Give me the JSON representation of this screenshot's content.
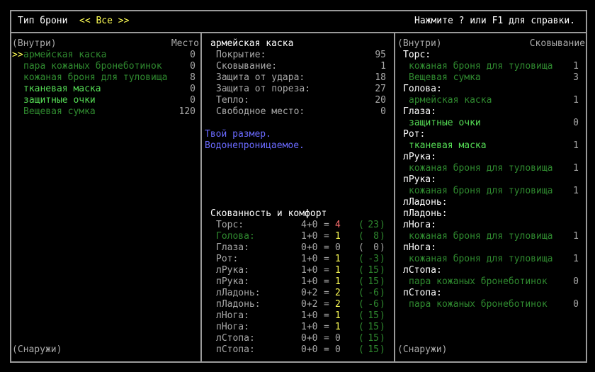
{
  "header": {
    "title": "Тип брони",
    "filter": "<< Все >>",
    "help": "Нажмите ? или F1 для справки."
  },
  "colors": {
    "gray": "#a8a8a8",
    "white": "#ffffff",
    "dark_green": "#2f8a2f",
    "light_green": "#55dd55",
    "yellow": "#ffff55",
    "red": "#ff7070",
    "blue": "#6a6aff",
    "border": "#9a9a9a"
  },
  "left": {
    "inside": "(Внутри)",
    "column": "Место",
    "outside": "(Снаружи)",
    "cursor": ">>",
    "items": [
      {
        "name": "армейская каска",
        "value": "0",
        "color": "dark_green",
        "selected": true
      },
      {
        "name": "пара кожаных бронеботинок",
        "value": "0",
        "color": "dark_green"
      },
      {
        "name": "кожаная броня для туловища",
        "value": "8",
        "color": "dark_green"
      },
      {
        "name": "тканевая маска",
        "value": "0",
        "color": "light_green"
      },
      {
        "name": "защитные очки",
        "value": "0",
        "color": "light_green"
      },
      {
        "name": "Вещевая сумка",
        "value": "120",
        "color": "dark_green"
      }
    ]
  },
  "middle": {
    "item_name": "армейская каска",
    "stats": [
      {
        "label": "Покрытие:",
        "value": "95"
      },
      {
        "label": "Сковывание:",
        "value": "1"
      },
      {
        "label": "Защита от удара:",
        "value": "18"
      },
      {
        "label": "Защита от пореза:",
        "value": "27"
      },
      {
        "label": "Тепло:",
        "value": "20"
      },
      {
        "label": "Свободное место:",
        "value": "0"
      }
    ],
    "notes": [
      "Твой размер.",
      "Водонепроницаемое."
    ],
    "encumbrance_title": "Скованность и комфорт",
    "encumbrance": [
      {
        "part": "Торс:",
        "sum": "4+0",
        "total": "4",
        "total_color": "red",
        "warmth": "23",
        "part_color": "gray",
        "warmth_color": "dark_green"
      },
      {
        "part": "Голова:",
        "sum": "1+0",
        "total": "1",
        "total_color": "yellow",
        "warmth": "8",
        "part_color": "dark_green",
        "warmth_color": "dark_green"
      },
      {
        "part": "Глаза:",
        "sum": "0+0",
        "total": "0",
        "total_color": "gray",
        "warmth": "0",
        "part_color": "gray",
        "warmth_color": "gray"
      },
      {
        "part": "Рот:",
        "sum": "1+0",
        "total": "1",
        "total_color": "yellow",
        "warmth": "-3",
        "part_color": "gray",
        "warmth_color": "dark_green"
      },
      {
        "part": "лРука:",
        "sum": "1+0",
        "total": "1",
        "total_color": "yellow",
        "warmth": "15",
        "part_color": "gray",
        "warmth_color": "dark_green"
      },
      {
        "part": "пРука:",
        "sum": "1+0",
        "total": "1",
        "total_color": "yellow",
        "warmth": "15",
        "part_color": "gray",
        "warmth_color": "dark_green"
      },
      {
        "part": "лЛадонь:",
        "sum": "0+2",
        "total": "2",
        "total_color": "yellow",
        "warmth": "-6",
        "part_color": "gray",
        "warmth_color": "dark_green"
      },
      {
        "part": "пЛадонь:",
        "sum": "0+2",
        "total": "2",
        "total_color": "yellow",
        "warmth": "-6",
        "part_color": "gray",
        "warmth_color": "dark_green"
      },
      {
        "part": "лНога:",
        "sum": "1+0",
        "total": "1",
        "total_color": "yellow",
        "warmth": "15",
        "part_color": "gray",
        "warmth_color": "dark_green"
      },
      {
        "part": "пНога:",
        "sum": "1+0",
        "total": "1",
        "total_color": "yellow",
        "warmth": "15",
        "part_color": "gray",
        "warmth_color": "dark_green"
      },
      {
        "part": "лСтопа:",
        "sum": "0+0",
        "total": "0",
        "total_color": "gray",
        "warmth": "15",
        "part_color": "gray",
        "warmth_color": "dark_green"
      },
      {
        "part": "пСтопа:",
        "sum": "0+0",
        "total": "0",
        "total_color": "gray",
        "warmth": "15",
        "part_color": "gray",
        "warmth_color": "dark_green"
      }
    ]
  },
  "right": {
    "inside": "(Внутри)",
    "column": "Сковывание",
    "outside": "(Снаружи)",
    "rows": [
      {
        "type": "part",
        "text": "Торс:"
      },
      {
        "type": "item",
        "text": "кожаная броня для туловища",
        "value": "1",
        "color": "dark_green"
      },
      {
        "type": "item",
        "text": "Вещевая сумка",
        "value": "3",
        "color": "dark_green"
      },
      {
        "type": "part",
        "text": "Голова:"
      },
      {
        "type": "item",
        "text": "армейская каска",
        "value": "1",
        "color": "dark_green"
      },
      {
        "type": "part",
        "text": "Глаза:"
      },
      {
        "type": "item",
        "text": "защитные очки",
        "value": "0",
        "color": "light_green"
      },
      {
        "type": "part",
        "text": "Рот:"
      },
      {
        "type": "item",
        "text": "тканевая маска",
        "value": "1",
        "color": "light_green"
      },
      {
        "type": "part",
        "text": "лРука:"
      },
      {
        "type": "item",
        "text": "кожаная броня для туловища",
        "value": "1",
        "color": "dark_green"
      },
      {
        "type": "part",
        "text": "пРука:"
      },
      {
        "type": "item",
        "text": "кожаная броня для туловища",
        "value": "1",
        "color": "dark_green"
      },
      {
        "type": "part",
        "text": "лЛадонь:"
      },
      {
        "type": "part",
        "text": "пЛадонь:"
      },
      {
        "type": "part",
        "text": "лНога:"
      },
      {
        "type": "item",
        "text": "кожаная броня для туловища",
        "value": "1",
        "color": "dark_green"
      },
      {
        "type": "part",
        "text": "пНога:"
      },
      {
        "type": "item",
        "text": "кожаная броня для туловища",
        "value": "1",
        "color": "dark_green"
      },
      {
        "type": "part",
        "text": "лСтопа:"
      },
      {
        "type": "item",
        "text": "пара кожаных бронеботинок",
        "value": "0",
        "color": "dark_green"
      },
      {
        "type": "part",
        "text": "пСтопа:"
      },
      {
        "type": "item",
        "text": "пара кожаных бронеботинок",
        "value": "0",
        "color": "dark_green"
      }
    ]
  }
}
